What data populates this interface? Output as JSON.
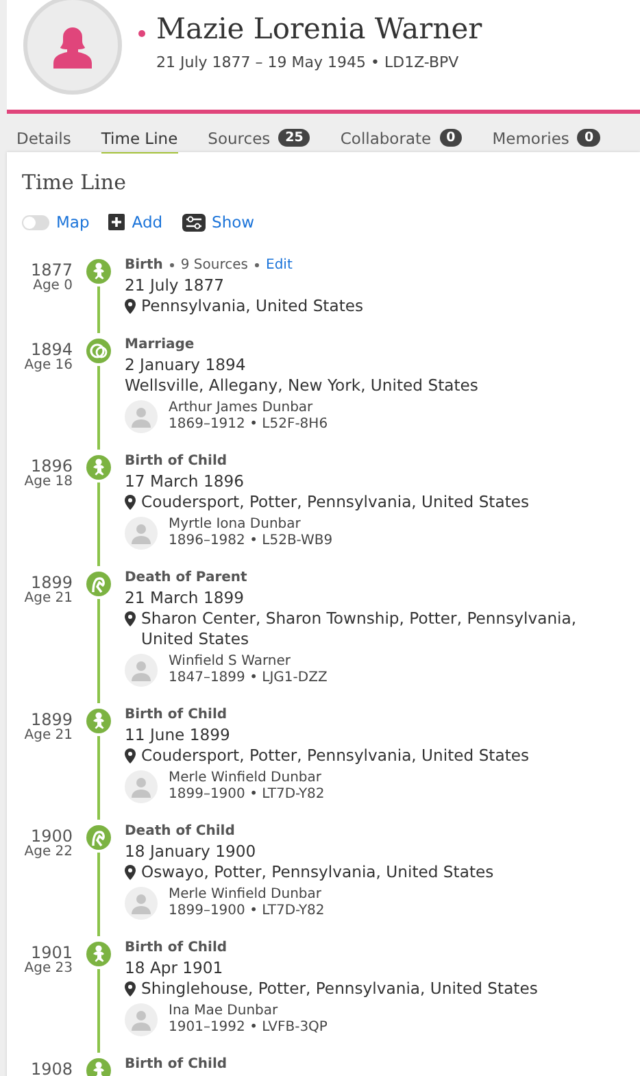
{
  "person": {
    "name": "Mazie Lorenia Warner",
    "summary": "21 July 1877 – 19 May 1945 • LD1Z-BPV"
  },
  "tabs": [
    {
      "label": "Details",
      "selected": false
    },
    {
      "label": "Time Line",
      "selected": true
    },
    {
      "label": "Sources",
      "count": "25",
      "selected": false
    },
    {
      "label": "Collaborate",
      "count": "0",
      "selected": false
    },
    {
      "label": "Memories",
      "count": "0",
      "selected": false
    }
  ],
  "timeline": {
    "title": "Time Line",
    "toolbar": {
      "map": {
        "label": "Map",
        "on": false
      },
      "add": "Add",
      "show": "Show"
    },
    "events": [
      {
        "kind": "birth",
        "year": "1877",
        "age": "Age 0",
        "title": "Birth",
        "sources": "9 Sources",
        "edit": "Edit",
        "date": "21 July 1877",
        "place": "Pennsylvania, United States",
        "pinned": true
      },
      {
        "kind": "marriage",
        "year": "1894",
        "age": "Age 16",
        "title": "Marriage",
        "date": "2 January 1894",
        "place": "Wellsville, Allegany, New York, United States",
        "pinned": false,
        "person": {
          "name": "Arthur James Dunbar",
          "info": "1869–1912 • L52F-8H6"
        }
      },
      {
        "kind": "birth",
        "year": "1896",
        "age": "Age 18",
        "title": "Birth of Child",
        "date": "17 March 1896",
        "place": "Coudersport, Potter, Pennsylvania, United States",
        "pinned": true,
        "person": {
          "name": "Myrtle Iona Dunbar",
          "info": "1896–1982 • L52B-WB9"
        }
      },
      {
        "kind": "death",
        "year": "1899",
        "age": "Age 21",
        "title": "Death of Parent",
        "date": "21 March 1899",
        "place": "Sharon Center, Sharon Township, Potter, Pennsylvania, United States",
        "pinned": true,
        "person": {
          "name": "Winfield S Warner",
          "info": "1847–1899 • LJG1-DZZ"
        }
      },
      {
        "kind": "birth",
        "year": "1899",
        "age": "Age 21",
        "title": "Birth of Child",
        "date": "11 June 1899",
        "place": "Coudersport, Potter, Pennsylvania, United States",
        "pinned": true,
        "person": {
          "name": "Merle Winfield Dunbar",
          "info": "1899–1900 • LT7D-Y82"
        }
      },
      {
        "kind": "death",
        "year": "1900",
        "age": "Age 22",
        "title": "Death of Child",
        "date": "18 January 1900",
        "place": "Oswayo, Potter, Pennsylvania, United States",
        "pinned": true,
        "person": {
          "name": "Merle Winfield Dunbar",
          "info": "1899–1900 • LT7D-Y82"
        }
      },
      {
        "kind": "birth",
        "year": "1901",
        "age": "Age 23",
        "title": "Birth of Child",
        "date": "18 Apr 1901",
        "place": "Shinglehouse, Potter, Pennsylvania, United States",
        "pinned": true,
        "person": {
          "name": "Ina Mae Dunbar",
          "info": "1901–1992 • LVFB-3QP"
        }
      },
      {
        "kind": "birth",
        "year": "1908",
        "title": "Birth of Child"
      }
    ]
  }
}
